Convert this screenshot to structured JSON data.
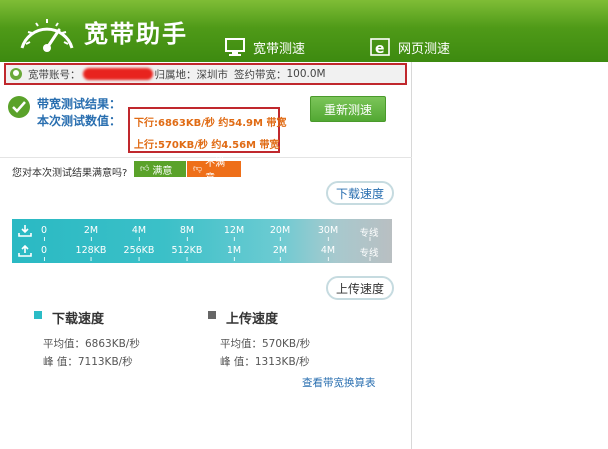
{
  "app": {
    "title": "宽带助手",
    "brand_color": "#4f9a18"
  },
  "nav": {
    "tabs": [
      {
        "label": "宽带测速",
        "icon": "monitor-icon"
      },
      {
        "label": "网页测速",
        "icon": "browser-e-icon"
      }
    ]
  },
  "account": {
    "account_label": "宽带账号：",
    "location_label": "归属地：",
    "location_value": "深圳市",
    "contract_label": "签约带宽：",
    "contract_value": "100.0M"
  },
  "result": {
    "label1": "带宽测试结果：",
    "label2": "本次测试数值：",
    "download": "下行:6863KB/秒 约54.9M 带宽",
    "upload": "上行:570KB/秒 约4.56M 带宽",
    "retest_label": "重新测速",
    "accent_color": "#e06b14"
  },
  "satisfaction": {
    "question": "您对本次测试结果满意吗?",
    "yes_label": "满意",
    "no_label": "不满意"
  },
  "speed_pills": {
    "download_label": "下载速度",
    "upload_label": "上传速度"
  },
  "scale": {
    "download_ticks": [
      "0",
      "2M",
      "4M",
      "8M",
      "12M",
      "20M",
      "30M",
      "专线"
    ],
    "upload_ticks": [
      "0",
      "128KB",
      "256KB",
      "512KB",
      "1M",
      "2M",
      "4M",
      "专线"
    ]
  },
  "stats": {
    "download_title": "下载速度",
    "download_avg": "平均值：6863KB/秒",
    "download_peak": "峰 值：7113KB/秒",
    "upload_title": "上传速度",
    "upload_avg": "平均值：570KB/秒",
    "upload_peak": "峰 值：1313KB/秒",
    "link_label": "查看带宽换算表"
  }
}
